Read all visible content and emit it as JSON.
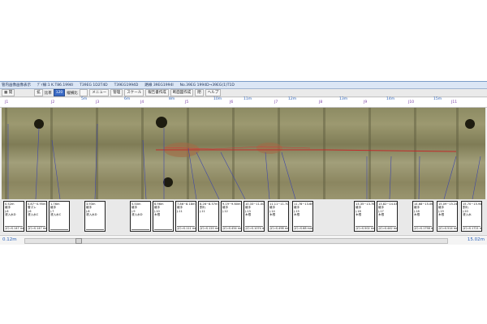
{
  "window": {
    "title_segments": [
      "管内画像画像表示",
      "ﾃﾞｲ線:1 K.T86.1994I",
      "T39EG 1D2T4D",
      "T39EG1994D",
      "路線 39EG1994I",
      "No.39EG 1994D→39EG(1)T1D"
    ]
  },
  "toolbar": {
    "open_label": "開",
    "zoom_label": "拡",
    "ratio_label": "比率",
    "ratio_value": "120",
    "scale_label": "縦横比",
    "menu_label": "メニュー",
    "manage_label": "管理",
    "scale_btn_label": "スケール",
    "report_label": "報告書作成",
    "edit_label": "断面図作成",
    "exit_label": "閉",
    "extra_label": "ヘルプ"
  },
  "ruler": {
    "joint_labels": [
      "J1",
      "J2",
      "J3",
      "J4",
      "J5",
      "J6",
      "J7",
      "J8",
      "J9",
      "J10",
      "J11"
    ],
    "distance_labels": [
      "5m",
      "6m",
      "8m",
      "10m",
      "11m",
      "12m",
      "13m",
      "14m",
      "15m"
    ]
  },
  "annotations": [
    {
      "range": "0.52m",
      "type": "継手",
      "sub": "J-6",
      "note": "浸入水D",
      "mm": "ｽｷﾏ=S.147 mm"
    },
    {
      "range": "0.87~0.95m",
      "type": "管ズレ",
      "sub": "J-6",
      "note": "浸入水C",
      "mm": "ｽｷﾏ=S.147 mm"
    },
    {
      "range": "1.76m",
      "type": "継手",
      "sub": "J-7",
      "note": "浸入水C",
      "mm": ""
    },
    {
      "range": "3.93m",
      "type": "継手",
      "sub": "J-8",
      "note": "浸入水D",
      "mm": ""
    },
    {
      "range": "5.50m",
      "type": "継手",
      "sub": "J-9",
      "note": "浸入水D",
      "mm": ""
    },
    {
      "range": "6.96m",
      "type": "継手",
      "sub": "J-10",
      "note": "木根",
      "mm": ""
    },
    {
      "range": "7.86~8.18m",
      "type": "継手",
      "sub": "J-11",
      "note": "",
      "mm": "ｽｷﾏ=S.111 mm"
    },
    {
      "range": "8.26~8.57m",
      "type": "割れ",
      "sub": "J-11",
      "note": "",
      "mm": "ｽｷﾏ=S.120 mm"
    },
    {
      "range": "9.19~9.60m",
      "type": "継手",
      "sub": "J-12",
      "note": "",
      "mm": "ｽｷﾏ=S.454 mm"
    },
    {
      "range": "10.33~11.00m",
      "type": "継手",
      "sub": "J-13",
      "note": "木根",
      "mm": "ｽｷﾏ=S.1074 mm"
    },
    {
      "range": "11.11~11.70m",
      "type": "継手",
      "sub": "J-14",
      "note": "木根",
      "mm": "ｽｷﾏ=S.498 mm"
    },
    {
      "range": "11.78~13.6m",
      "type": "継手",
      "sub": "J-15",
      "note": "木根",
      "mm": "ｽｷﾏ=S.68 mm"
    },
    {
      "range": "13.35~13.76m",
      "type": "継手",
      "sub": "J-16",
      "note": "木根",
      "mm": "ｽｷﾏ=S.502 mm"
    },
    {
      "range": "13.82~14.43m",
      "type": "継手",
      "sub": "J-17",
      "note": "木根",
      "mm": "ｽｷﾏ=S.442 mm"
    },
    {
      "range": "14.68~15.06m",
      "type": "継手",
      "sub": "J-18",
      "note": "木根",
      "mm": "ｽｷﾏ=S.1758 mm"
    },
    {
      "range": "15.09~15.24m",
      "type": "継手",
      "sub": "J-19",
      "note": "木根",
      "mm": "ｽｷﾏ=S.514 mm"
    },
    {
      "range": "15.70~15.94m",
      "type": "割れ",
      "sub": "J-20",
      "note": "浸入水",
      "mm": "ｽｷﾏ=S.1721 mm"
    }
  ],
  "status": {
    "left_position": "0.12m",
    "right_position": "15.02m"
  }
}
